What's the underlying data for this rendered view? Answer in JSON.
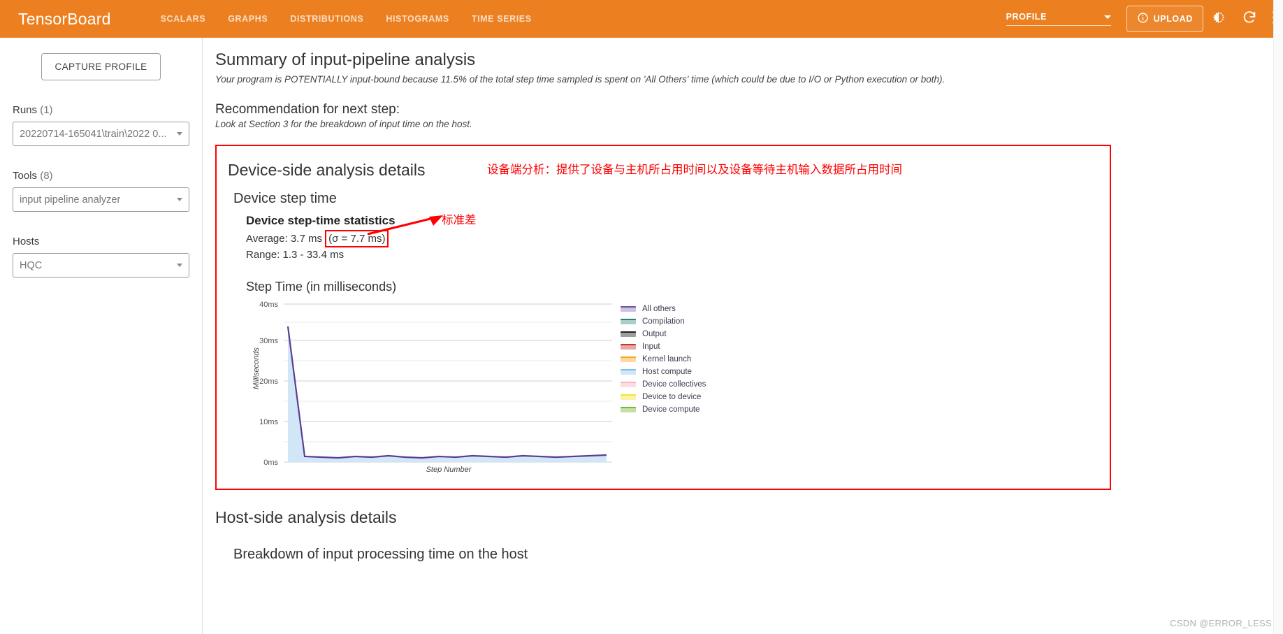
{
  "header": {
    "brand": "TensorBoard",
    "nav": [
      {
        "label": "SCALARS"
      },
      {
        "label": "GRAPHS"
      },
      {
        "label": "DISTRIBUTIONS"
      },
      {
        "label": "HISTOGRAMS"
      },
      {
        "label": "TIME SERIES"
      }
    ],
    "active_plugin": "PROFILE",
    "upload_label": "UPLOAD",
    "accent_color": "#ec8021",
    "icons": {
      "info": "info-icon",
      "brightness": "brightness-icon",
      "refresh": "refresh-icon",
      "settings": "settings-icon"
    }
  },
  "sidebar": {
    "capture_button": "CAPTURE PROFILE",
    "runs": {
      "label": "Runs",
      "count": "(1)",
      "value": "20220714-165041\\train\\2022 0..."
    },
    "tools": {
      "label": "Tools",
      "count": "(8)",
      "value": "input pipeline analyzer"
    },
    "hosts": {
      "label": "Hosts",
      "count": "",
      "value": "HQC"
    }
  },
  "main": {
    "summary_title": "Summary of input-pipeline analysis",
    "summary_note": "Your program is POTENTIALLY input-bound because 11.5% of the total step time sampled is spent on 'All Others' time (which could be due to I/O or Python execution or both).",
    "recommendation_title": "Recommendation for next step:",
    "recommendation_note": "Look at Section 3 for the breakdown of input time on the host.",
    "device_section_title": "Device-side analysis details",
    "device_step_time_title": "Device step time",
    "stats_title": "Device step-time statistics",
    "average_prefix": "Average: 3.7 ms ",
    "sigma_text": "(σ = 7.7 ms)",
    "range_text": "Range: 1.3 - 33.4 ms",
    "host_section_title": "Host-side analysis details",
    "breakdown_title": "Breakdown of input processing time on the host",
    "annotation_device": "设备端分析：提供了设备与主机所占用时间以及设备等待主机输入数据所占用时间",
    "annotation_sigma": "标准差",
    "annotation_color": "#ff0000",
    "watermark": "CSDN @ERROR_LESS"
  },
  "chart_data": {
    "type": "area",
    "title": "Step Time (in milliseconds)",
    "xlabel": "Step Number",
    "ylabel": "Milliseconds",
    "ylim": [
      0,
      40
    ],
    "yticks": [
      0,
      10,
      20,
      30,
      40
    ],
    "ytick_labels": [
      "0ms",
      "10ms",
      "20ms",
      "30ms",
      "40ms"
    ],
    "minor_gridlines": [
      5,
      15,
      25,
      35
    ],
    "grid": true,
    "legend_position": "right",
    "x": [
      1,
      2,
      3,
      4,
      5,
      6,
      7,
      8,
      9,
      10,
      11,
      12,
      13,
      14,
      15,
      16,
      17,
      18,
      19,
      20
    ],
    "series": [
      {
        "name": "All others",
        "color": "#6a51a3",
        "fill": "#cbc3e3",
        "values": [
          33.4,
          1.5,
          1.4,
          1.3,
          1.5,
          1.4,
          1.6,
          1.4,
          1.3,
          1.5,
          1.4,
          1.6,
          1.5,
          1.4,
          1.6,
          1.5,
          1.4,
          1.5,
          1.6,
          1.7
        ]
      },
      {
        "name": "Compilation",
        "color": "#2d7f7a",
        "fill": "#a9cfca",
        "values": [
          0,
          0,
          0,
          0,
          0,
          0,
          0,
          0,
          0,
          0,
          0,
          0,
          0,
          0,
          0,
          0,
          0,
          0,
          0,
          0
        ]
      },
      {
        "name": "Output",
        "color": "#222222",
        "fill": "#9e9e9e",
        "values": [
          0,
          0,
          0,
          0,
          0,
          0,
          0,
          0,
          0,
          0,
          0,
          0,
          0,
          0,
          0,
          0,
          0,
          0,
          0,
          0
        ]
      },
      {
        "name": "Input",
        "color": "#c0392b",
        "fill": "#e8a8a3",
        "values": [
          0,
          0,
          0,
          0,
          0,
          0,
          0,
          0,
          0,
          0,
          0,
          0,
          0,
          0,
          0,
          0,
          0,
          0,
          0,
          0
        ]
      },
      {
        "name": "Kernel launch",
        "color": "#f5a623",
        "fill": "#fbd9a0",
        "values": [
          0,
          0,
          0,
          0,
          0,
          0,
          0,
          0,
          0,
          0,
          0,
          0,
          0,
          0,
          0,
          0,
          0,
          0,
          0,
          0
        ]
      },
      {
        "name": "Host compute",
        "color": "#7fbfe8",
        "fill": "#cfe7f7",
        "values": [
          0,
          0,
          0,
          0,
          0,
          0,
          0,
          0,
          0,
          0,
          0,
          0,
          0,
          0,
          0,
          0,
          0,
          0,
          0,
          0
        ]
      },
      {
        "name": "Device collectives",
        "color": "#f7b6c2",
        "fill": "#fbdde3",
        "values": [
          0,
          0,
          0,
          0,
          0,
          0,
          0,
          0,
          0,
          0,
          0,
          0,
          0,
          0,
          0,
          0,
          0,
          0,
          0,
          0
        ]
      },
      {
        "name": "Device to device",
        "color": "#f2e53a",
        "fill": "#f9f3a8",
        "values": [
          0,
          0,
          0,
          0,
          0,
          0,
          0,
          0,
          0,
          0,
          0,
          0,
          0,
          0,
          0,
          0,
          0,
          0,
          0,
          0
        ]
      },
      {
        "name": "Device compute",
        "color": "#7cb342",
        "fill": "#c5e0a5",
        "values": [
          0,
          0,
          0,
          0,
          0,
          0,
          0,
          0,
          0,
          0,
          0,
          0,
          0,
          0,
          0,
          0,
          0,
          0,
          0,
          0
        ]
      }
    ]
  }
}
